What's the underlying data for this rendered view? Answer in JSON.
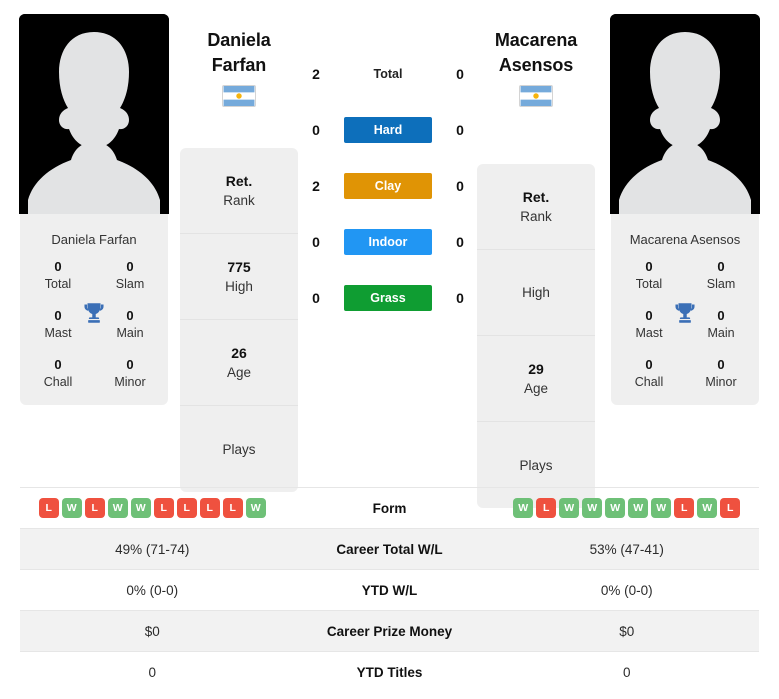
{
  "players": {
    "left": {
      "first_name": "Daniela",
      "last_name": "Farfan",
      "full_name": "Daniela Farfan",
      "country": "Argentina",
      "flag_icon": "argentina-flag-icon",
      "avatar_icon": "player-silhouette-icon",
      "titles": {
        "total_value": "0",
        "total_label": "Total",
        "slam_value": "0",
        "slam_label": "Slam",
        "mast_value": "0",
        "mast_label": "Mast",
        "main_value": "0",
        "main_label": "Main",
        "chall_value": "0",
        "chall_label": "Chall",
        "minor_value": "0",
        "minor_label": "Minor",
        "trophy_icon": "trophy-icon"
      },
      "info": [
        {
          "value": "Ret.",
          "label": "Rank"
        },
        {
          "value": "775",
          "label": "High"
        },
        {
          "value": "26",
          "label": "Age"
        },
        {
          "value": "",
          "label": "Plays"
        }
      ],
      "surface_wins": {
        "total": "2",
        "hard": "0",
        "clay": "2",
        "indoor": "0",
        "grass": "0"
      },
      "form": [
        "L",
        "W",
        "L",
        "W",
        "W",
        "L",
        "L",
        "L",
        "L",
        "W"
      ],
      "career_total_wl": "49% (71-74)",
      "ytd_wl": "0% (0-0)",
      "career_prize_money": "$0",
      "ytd_titles": "0"
    },
    "right": {
      "first_name": "Macarena",
      "last_name": "Asensos",
      "full_name": "Macarena Asensos",
      "country": "Argentina",
      "flag_icon": "argentina-flag-icon",
      "avatar_icon": "player-silhouette-icon",
      "titles": {
        "total_value": "0",
        "total_label": "Total",
        "slam_value": "0",
        "slam_label": "Slam",
        "mast_value": "0",
        "mast_label": "Mast",
        "main_value": "0",
        "main_label": "Main",
        "chall_value": "0",
        "chall_label": "Chall",
        "minor_value": "0",
        "minor_label": "Minor",
        "trophy_icon": "trophy-icon"
      },
      "info": [
        {
          "value": "Ret.",
          "label": "Rank"
        },
        {
          "value": "",
          "label": "High"
        },
        {
          "value": "29",
          "label": "Age"
        },
        {
          "value": "",
          "label": "Plays"
        }
      ],
      "surface_wins": {
        "total": "0",
        "hard": "0",
        "clay": "0",
        "indoor": "0",
        "grass": "0"
      },
      "form": [
        "W",
        "L",
        "W",
        "W",
        "W",
        "W",
        "W",
        "L",
        "W",
        "L"
      ],
      "career_total_wl": "53% (47-41)",
      "ytd_wl": "0% (0-0)",
      "career_prize_money": "$0",
      "ytd_titles": "0"
    }
  },
  "surfaces": [
    {
      "key": "total",
      "label": "Total",
      "color": "transparent",
      "text_color": "#222222"
    },
    {
      "key": "hard",
      "label": "Hard",
      "color": "#0d6fbb",
      "text_color": "#ffffff"
    },
    {
      "key": "clay",
      "label": "Clay",
      "color": "#e09405",
      "text_color": "#ffffff"
    },
    {
      "key": "indoor",
      "label": "Indoor",
      "color": "#2196f3",
      "text_color": "#ffffff"
    },
    {
      "key": "grass",
      "label": "Grass",
      "color": "#0f9d32",
      "text_color": "#ffffff"
    }
  ],
  "stats_rows": [
    {
      "label": "Form"
    },
    {
      "label": "Career Total W/L"
    },
    {
      "label": "YTD W/L"
    },
    {
      "label": "Career Prize Money"
    },
    {
      "label": "YTD Titles"
    }
  ],
  "colors": {
    "win_badge": "#6ec077",
    "loss_badge": "#ef513f",
    "card_bg": "#efefef",
    "row_alt_bg": "#f2f2f2",
    "flag_blue": "#75aadb",
    "flag_sun": "#f6b40e"
  }
}
